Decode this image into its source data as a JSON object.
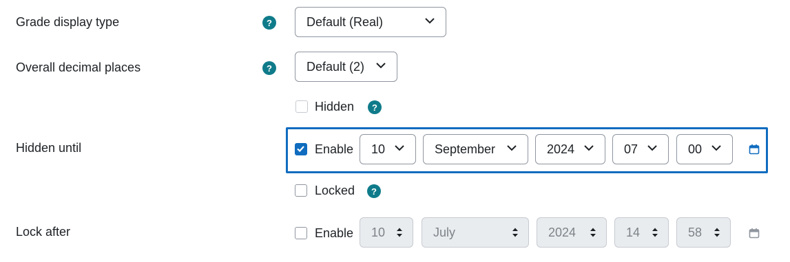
{
  "grade_display": {
    "label": "Grade display type",
    "value": "Default (Real)"
  },
  "decimal_places": {
    "label": "Overall decimal places",
    "value": "Default (2)"
  },
  "hidden": {
    "checkbox_label": "Hidden",
    "checked": false
  },
  "hidden_until": {
    "label": "Hidden until",
    "enable_label": "Enable",
    "enabled": true,
    "day": "10",
    "month": "September",
    "year": "2024",
    "hour": "07",
    "minute": "00"
  },
  "locked": {
    "checkbox_label": "Locked",
    "checked": false
  },
  "lock_after": {
    "label": "Lock after",
    "enable_label": "Enable",
    "enabled": false,
    "day": "10",
    "month": "July",
    "year": "2024",
    "hour": "14",
    "minute": "58"
  },
  "icons": {
    "help": "question-mark-icon",
    "calendar": "calendar-icon",
    "dropdown": "chevron-down-icon"
  },
  "colors": {
    "accent": "#0f6cbf",
    "help": "#0f7b8a",
    "text": "#1d2125",
    "disabled_bg": "#e9ecef"
  }
}
